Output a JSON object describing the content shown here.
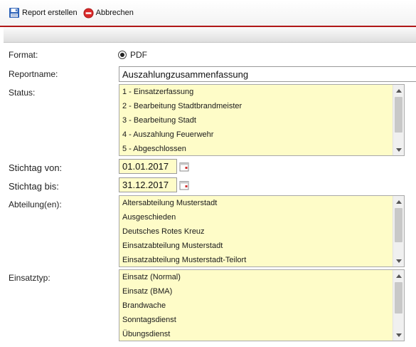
{
  "toolbar": {
    "create_label": "Report erstellen",
    "cancel_label": "Abbrechen"
  },
  "form": {
    "format": {
      "label": "Format:",
      "option": "PDF"
    },
    "reportname": {
      "label": "Reportname:",
      "value": "Auszahlungzusammenfassung"
    },
    "status": {
      "label": "Status:",
      "items": [
        "1 - Einsatzerfassung",
        "2 - Bearbeitung Stadtbrandmeister",
        "3 - Bearbeitung Stadt",
        "4 - Auszahlung Feuerwehr",
        "5 - Abgeschlossen"
      ]
    },
    "stichtag_von": {
      "label": "Stichtag von:",
      "value": "01.01.2017"
    },
    "stichtag_bis": {
      "label": "Stichtag bis:",
      "value": "31.12.2017"
    },
    "abteilung": {
      "label": "Abteilung(en):",
      "items": [
        "Altersabteilung Musterstadt",
        "Ausgeschieden",
        "Deutsches Rotes Kreuz",
        "Einsatzabteilung Musterstadt",
        "Einsatzabteilung Musterstadt-Teilort"
      ]
    },
    "einsatztyp": {
      "label": "Einsatztyp:",
      "items": [
        "Einsatz (Normal)",
        "Einsatz (BMA)",
        "Brandwache",
        "Sonntagsdienst",
        "Übungsdienst"
      ]
    }
  },
  "icons": {
    "create": "save-disk-icon",
    "cancel": "cancel-circle-icon",
    "calendar": "calendar-icon"
  },
  "colors": {
    "accent_line": "#b01818",
    "list_background": "#fefcc8",
    "cancel_icon": "#d92a2a",
    "save_icon": "#2e63b8"
  }
}
